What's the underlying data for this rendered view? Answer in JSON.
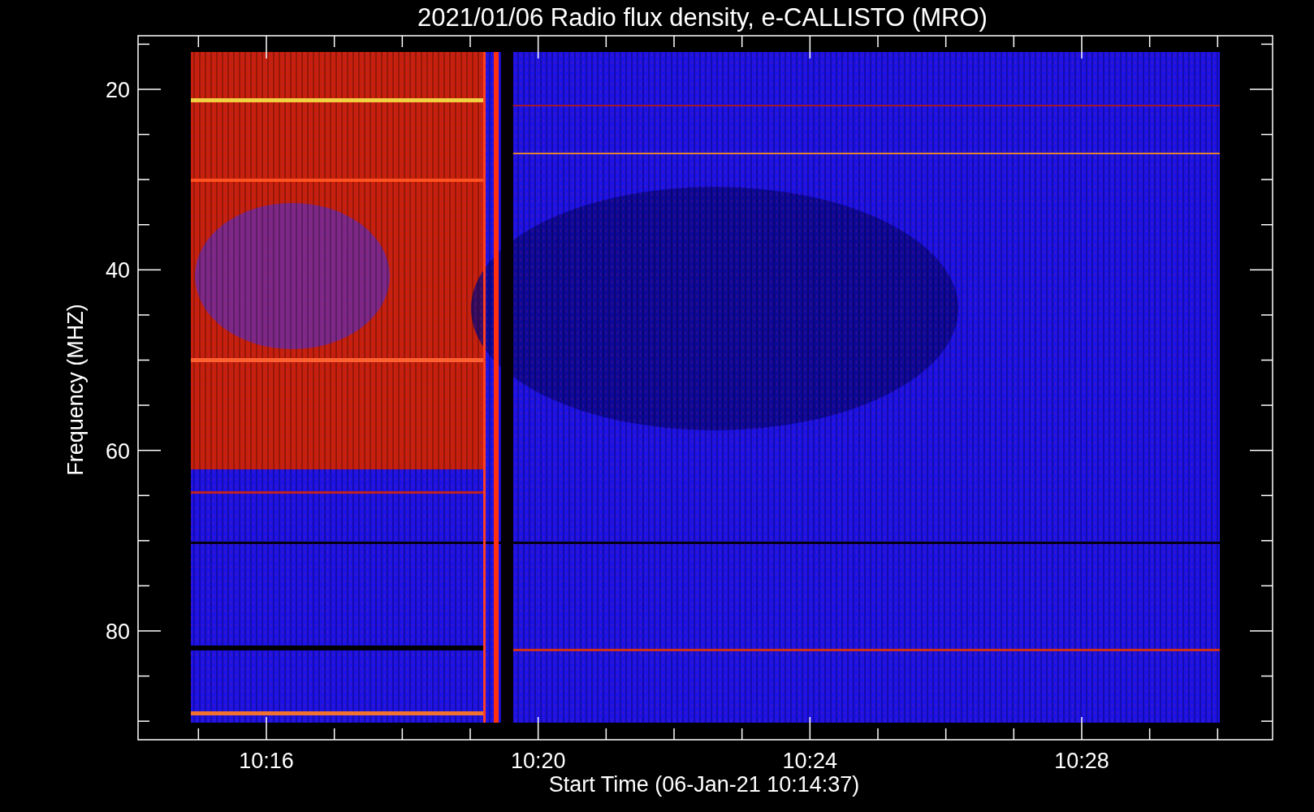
{
  "title": "2021/01/06  Radio flux density, e-CALLISTO (MRO)",
  "y_axis": {
    "label": "Frequency (MHZ)",
    "tick_labels": [
      "20",
      "40",
      "60",
      "80"
    ]
  },
  "x_axis": {
    "label": "Start Time (06-Jan-21 10:14:37)",
    "tick_labels": [
      "10:16",
      "10:20",
      "10:24",
      "10:28"
    ]
  }
}
